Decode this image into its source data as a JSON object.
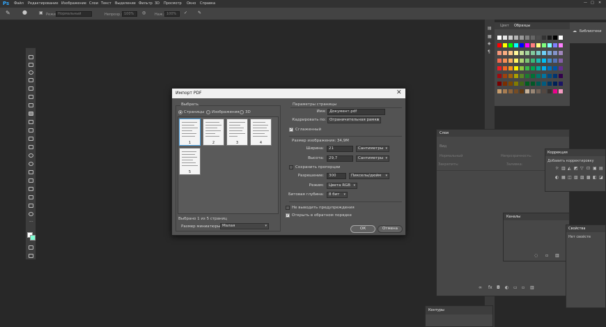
{
  "app": {
    "logo": "Ps"
  },
  "menu": [
    "Файл",
    "Редактирование",
    "Изображение",
    "Слои",
    "Текст",
    "Выделение",
    "Фильтр",
    "3D",
    "Просмотр",
    "Окно",
    "Справка"
  ],
  "options_bar": {
    "mode_label": "Режим:",
    "mode_value": "Нормальный",
    "opacity_label": "Непрозр.:",
    "opacity_value": "100%",
    "flow_label": "Наж.:",
    "flow_value": "100%"
  },
  "swatches_panel": {
    "tabs": [
      "Цвет",
      "Образцы"
    ],
    "colors": [
      [
        "#ffffff",
        "#e6e6e6",
        "#cccccc",
        "#b3b3b3",
        "#999999",
        "#808080",
        "#666666",
        "#4d4d4d",
        "#333333",
        "#1a1a1a",
        "#000000",
        "#ffffff"
      ],
      [
        "#ff0000",
        "#ffff00",
        "#00ff00",
        "#00ffff",
        "#0000ff",
        "#ff00ff",
        "#ff7f7f",
        "#ffff7f",
        "#7fff7f",
        "#7fffff",
        "#7f7fff",
        "#ff7fff"
      ],
      [
        "#f7977a",
        "#f9ad81",
        "#fdc68a",
        "#fff79a",
        "#c4df9b",
        "#a3d39c",
        "#82ca9d",
        "#7bcdc8",
        "#6ecff6",
        "#7ea7d8",
        "#8493ca",
        "#a187be"
      ],
      [
        "#f26c4f",
        "#f68e55",
        "#fbaf5c",
        "#fff467",
        "#acd372",
        "#7cc576",
        "#3bb878",
        "#1abbb4",
        "#00bff3",
        "#438ccb",
        "#5574b9",
        "#8560a8"
      ],
      [
        "#ed1c24",
        "#f26522",
        "#f7941d",
        "#fff200",
        "#8dc73f",
        "#39b54a",
        "#00a651",
        "#00a99d",
        "#00aeef",
        "#0072bc",
        "#0054a6",
        "#662d91"
      ],
      [
        "#9e0b0f",
        "#a0410d",
        "#a36209",
        "#aba000",
        "#598527",
        "#1a7b30",
        "#007236",
        "#00746b",
        "#0076a3",
        "#004b80",
        "#003471",
        "#32004b"
      ],
      [
        "#790000",
        "#7b2e00",
        "#7d4900",
        "#827b00",
        "#406618",
        "#005e20",
        "#005826",
        "#005952",
        "#005b7f",
        "#003663",
        "#002157",
        "#1b1464"
      ],
      [
        "#c69c6d",
        "#a67c52",
        "#8c6239",
        "#754c24",
        "#603913",
        "#c7b299",
        "#998675",
        "#736357",
        "#534741",
        "#362f2d",
        "#ec008c",
        "#f49ac1"
      ]
    ]
  },
  "libraries_panel": {
    "label": "Библиотеки"
  },
  "layers_panel": {
    "title": "Слои",
    "kind": "Вид",
    "blend": "Нормальный",
    "opacity_label": "Непрозрачность:",
    "lock_label": "Закрепить:",
    "fill_label": "Заливка:"
  },
  "corrections_panel": {
    "title": "Коррекция",
    "subtitle": "Добавить корректировку"
  },
  "channels_panel": {
    "title": "Каналы"
  },
  "props_panel": {
    "title": "Свойства",
    "subtitle": "Нет свойств"
  },
  "paths_panel": {
    "title": "Контуры"
  },
  "dialog": {
    "title": "Импорт PDF",
    "select_group": "Выбрать",
    "radio_pages": "Страницы",
    "radio_images": "Изображения",
    "radio_3d": "3D",
    "thumbs": [
      "1",
      "2",
      "3",
      "4",
      "5"
    ],
    "selected_info": "Выбрано 1 из 5 страниц",
    "thumb_size_label": "Размер миниатюры:",
    "thumb_size_value": "Малая",
    "page_params": "Параметры страницы",
    "name_label": "Имя:",
    "name_value": "Документ.pdf",
    "crop_label": "Кадрировать по:",
    "crop_value": "Ограничительная рамка",
    "anti_alias": "Сглаженный",
    "image_size": "Размер изображения: 34,9M",
    "width_label": "Ширина:",
    "width_value": "21",
    "width_unit": "Сантиметры",
    "height_label": "Высота:",
    "height_value": "29,7",
    "height_unit": "Сантиметры",
    "keep_proportions": "Сохранить пропорции",
    "resolution_label": "Разрешение:",
    "resolution_value": "300",
    "resolution_unit": "Пикселы/дюйм",
    "mode_label": "Режим:",
    "mode_value": "Цвета RGB",
    "depth_label": "Битовая глубина:",
    "depth_value": "8 бит",
    "suppress_warnings": "Не выводить предупреждения",
    "reverse_order": "Открыть в обратном порядке",
    "ok": "ОК",
    "cancel": "Отмена"
  }
}
